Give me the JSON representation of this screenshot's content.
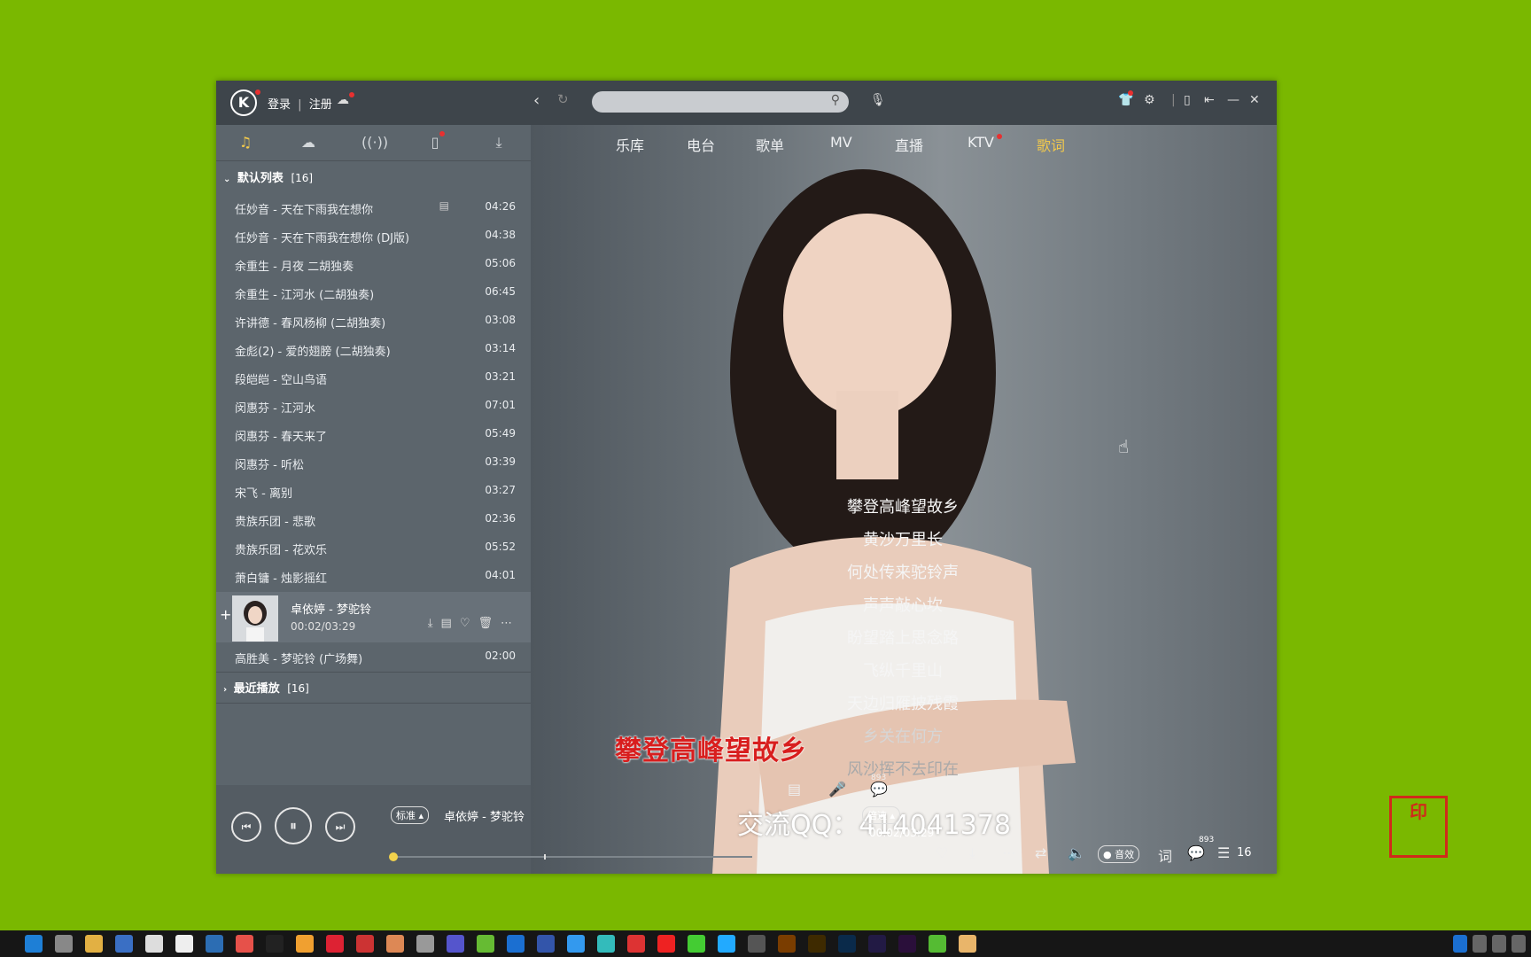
{
  "titlebar": {
    "logo": "K",
    "login": "登录",
    "register": "注册",
    "sep": "|"
  },
  "left_tabs": [
    "music-note-icon",
    "cloud-icon",
    "radio-icon",
    "phone-icon",
    "download-icon"
  ],
  "playlist": {
    "title": "默认列表",
    "count": "[16]",
    "songs": [
      {
        "name": "任妙音 - 天在下雨我在想你",
        "dur": "04:26"
      },
      {
        "name": "任妙音 - 天在下雨我在想你 (DJ版)",
        "dur": "04:38"
      },
      {
        "name": "余重生 - 月夜 二胡独奏",
        "dur": "05:06"
      },
      {
        "name": "余重生 - 江河水 (二胡独奏)",
        "dur": "06:45"
      },
      {
        "name": "许讲德 - 春风杨柳 (二胡独奏)",
        "dur": "03:08"
      },
      {
        "name": "金彪(2) - 爱的翅膀 (二胡独奏)",
        "dur": "03:14"
      },
      {
        "name": "段皑皑 - 空山鸟语",
        "dur": "03:21"
      },
      {
        "name": "闵惠芬 - 江河水",
        "dur": "07:01"
      },
      {
        "name": "闵惠芬 - 春天来了",
        "dur": "05:49"
      },
      {
        "name": "闵惠芬 - 听松",
        "dur": "03:39"
      },
      {
        "name": "宋飞 - 离别",
        "dur": "03:27"
      },
      {
        "name": "贵族乐团 - 悲歌",
        "dur": "02:36"
      },
      {
        "name": "贵族乐团 - 花欢乐",
        "dur": "05:52"
      },
      {
        "name": "萧白镛 - 烛影摇红",
        "dur": "04:01"
      }
    ],
    "now_playing": {
      "name": "卓依婷 - 梦驼铃",
      "time": "00:02/03:29"
    },
    "after": {
      "name": "高胜美 - 梦驼铃 (广场舞)",
      "dur": "02:00"
    },
    "recent_title": "最近播放",
    "recent_count": "[16]"
  },
  "topnav": [
    "乐库",
    "电台",
    "歌单",
    "MV",
    "直播",
    "KTV",
    "歌词"
  ],
  "active_nav": "歌词",
  "lyrics": [
    "攀登高峰望故乡",
    "黄沙万里长",
    "何处传来驼铃声",
    "声声敲心坎",
    "盼望踏上思念路",
    "飞纵千里山",
    "天边归雁披残霞",
    "乡关在何方",
    "风沙挥不去印在"
  ],
  "karaoke_line": "攀登高峰望故乡",
  "comment_count": "893",
  "qq_text": "交流QQ：414041378",
  "player": {
    "quality": "标准",
    "song": "卓依婷 - 梦驼铃",
    "speed": "倍速",
    "time": "00:02/03:29",
    "effect": "音效",
    "lyric_btn": "词",
    "comment_count": "893",
    "queue_count": "16",
    "progress": 0.01
  },
  "colors": {
    "accent": "#f2c94c",
    "background": "#7ab800",
    "karaoke": "#d81e1e"
  }
}
